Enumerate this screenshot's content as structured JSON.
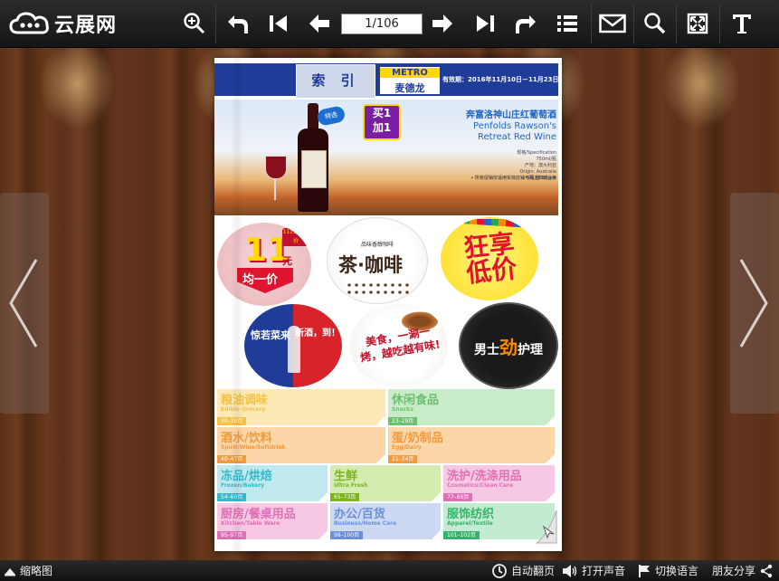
{
  "app": {
    "logo_text": "云展网"
  },
  "toolbar": {
    "page_indicator": "1/106",
    "icons": [
      "zoom-in-icon",
      "undo-icon",
      "first-page-icon",
      "prev-page-icon",
      "next-page-icon",
      "last-page-icon",
      "redo-icon",
      "list-icon",
      "mail-icon",
      "search-icon",
      "fullscreen-icon",
      "text-icon"
    ]
  },
  "page": {
    "header": {
      "index_label": "索 引",
      "metro_brand": "METRO",
      "metro_cn": "麦德龙",
      "validity": "有效期：2016年11月10日－11月23日"
    },
    "banner": {
      "badge_left": "特选",
      "badge_right_line1": "买1",
      "badge_right_line2": "加1",
      "title_cn": "奔富洛神山庄红葡萄酒",
      "title_en_1": "Penfolds Rawson's",
      "title_en_2": "Retreat Red Wine",
      "details": [
        "规格/Specification",
        "750ml/瓶",
        "产地：澳大利亚",
        "Origin: Australia",
        "6瓶/箱 6/case"
      ],
      "footnote": "• 所有促销仅适用实体店铺与网上商城业务"
    },
    "promos": {
      "sale11": {
        "tag": "1111 狂享价",
        "number": "11",
        "unit": "元",
        "caption": "均一价"
      },
      "coffee": {
        "subtitle": "品味香醇咖啡",
        "title": "茶·咖啡"
      },
      "crazy": {
        "title": "狂享低价"
      },
      "drinks": {
        "left": "惊若菜来",
        "right": "新酒，到！"
      },
      "food": {
        "title": "美食，一涮一烤，越吃越有味!"
      },
      "mens": {
        "pre": "男士",
        "highlight": "劲",
        "post": "护理"
      }
    },
    "categories": [
      {
        "cn": "粮油调味",
        "en": "Edible Grocery",
        "pages": "30–38页",
        "color": "#f5c242",
        "bg": "#fce9b5"
      },
      {
        "cn": "休闲食品",
        "en": "Snacks",
        "pages": "23–29页",
        "color": "#6cc070",
        "bg": "#c8ecc7"
      },
      {
        "cn": "酒水/饮料",
        "en": "Spirit/Wine/Softdrink",
        "pages": "40–47页",
        "color": "#f29a3c",
        "bg": "#fbd6a8"
      },
      {
        "cn": "蛋/奶制品",
        "en": "Egg/Dairy",
        "pages": "21–34页",
        "color": "#f29a3c",
        "bg": "#fbd6a8"
      },
      {
        "cn": "冻品/烘焙",
        "en": "Frozen/Bakery",
        "pages": "54–60页",
        "color": "#38b8c8",
        "bg": "#bfe9ee"
      },
      {
        "cn": "生鲜",
        "en": "Ultra Fresh",
        "pages": "65–73页",
        "color": "#7ab51d",
        "bg": "#d5ecb0"
      },
      {
        "cn": "洗护/洗涤用品",
        "en": "Cosmetics/Clean Care",
        "pages": "77–86页",
        "color": "#e06fb5",
        "bg": "#f6c8e4"
      },
      {
        "cn": "厨房/餐桌用品",
        "en": "Kitchen/Table Ware",
        "pages": "95–97页",
        "color": "#e06fb5",
        "bg": "#f6c8e4"
      },
      {
        "cn": "办公/百货",
        "en": "Business/Home Care",
        "pages": "98–100页",
        "color": "#6a8fd8",
        "bg": "#cdd9f3"
      },
      {
        "cn": "服饰纺织",
        "en": "Apparel/Textile",
        "pages": "101–102页",
        "color": "#33b46a",
        "bg": "#c3ebd2"
      }
    ]
  },
  "bottombar": {
    "thumbnails_label": "缩略图",
    "autoflip_label": "自动翻页",
    "sound_label": "打开声音",
    "language_label": "切换语言",
    "share_label": "朋友分享"
  }
}
